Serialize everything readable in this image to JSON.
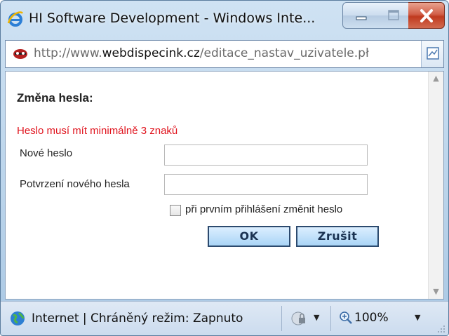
{
  "window": {
    "title": "HI Software Development - Windows Inte..."
  },
  "address_bar": {
    "url_prefix": "http://www.",
    "url_domain": "webdispecink.cz",
    "url_path": "/editace_nastav_uzivatele.pł",
    "icons": [
      "site-favicon-icon",
      "compatibility-view-icon"
    ]
  },
  "form": {
    "heading": "Změna hesla:",
    "error": "Heslo musí mít minimálně 3 znaků",
    "new_password_label": "Nové heslo",
    "new_password_value": "",
    "confirm_password_label": "Potvrzení nového hesla",
    "confirm_password_value": "",
    "checkbox_label": "při prvním přihlášení změnit heslo",
    "checkbox_checked": false,
    "ok_label": "OK",
    "cancel_label": "Zrušit"
  },
  "status_bar": {
    "zone_text": "Internet | Chráněný režim: Zapnuto",
    "zoom": "100%",
    "icons": [
      "globe-icon",
      "protected-mode-icon",
      "zoom-icon"
    ]
  },
  "colors": {
    "error": "#e0141e",
    "button_fill": "#a9d5f6",
    "button_border": "#2c4a6e",
    "close_button": "#c03a1f"
  }
}
